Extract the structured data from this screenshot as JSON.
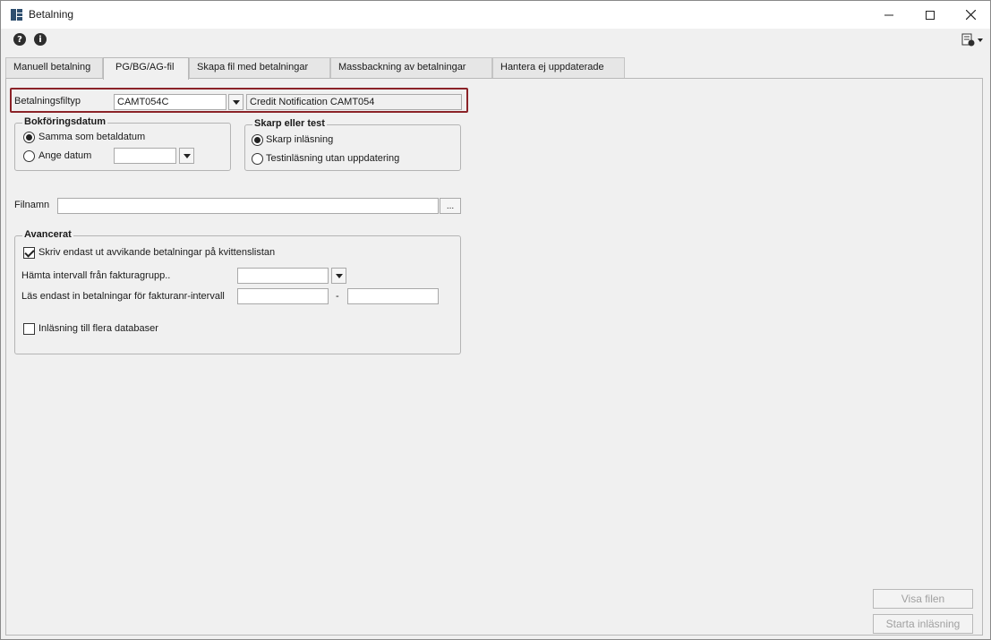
{
  "window": {
    "title": "Betalning"
  },
  "toolbar": {
    "help_icon_glyph": "?",
    "info_icon_glyph": "i"
  },
  "tabs": [
    {
      "label": "Manuell betalning",
      "active": false
    },
    {
      "label": "PG/BG/AG-fil",
      "active": true
    },
    {
      "label": "Skapa fil med betalningar",
      "active": false
    },
    {
      "label": "Massbackning av betalningar",
      "active": false
    },
    {
      "label": "Hantera ej uppdaterade",
      "active": false
    }
  ],
  "filetype": {
    "label": "Betalningsfiltyp",
    "value": "CAMT054C",
    "description": "Credit Notification CAMT054"
  },
  "bookdate": {
    "title": "Bokföringsdatum",
    "option_same": "Samma som betaldatum",
    "option_specify": "Ange datum",
    "date_value": "",
    "selected": "same"
  },
  "mode": {
    "title": "Skarp eller test",
    "option_live": "Skarp inläsning",
    "option_test": "Testinläsning utan uppdatering",
    "selected": "live"
  },
  "file": {
    "label": "Filnamn",
    "value": "",
    "browse_label": "..."
  },
  "advanced": {
    "title": "Avancerat",
    "only_deviating_label": "Skriv endast ut avvikande betalningar på kvittenslistan",
    "only_deviating_checked": true,
    "interval_group_label": "Hämta intervall från fakturagrupp..",
    "interval_group_value": "",
    "invoice_range_label": "Läs endast in betalningar för fakturanr-intervall",
    "invoice_from": "",
    "range_separator": "-",
    "invoice_to": "",
    "multi_db_label": "Inläsning till flera databaser",
    "multi_db_checked": false
  },
  "actions": {
    "show_file_label": "Visa filen",
    "start_import_label": "Starta inläsning"
  },
  "colors": {
    "highlight_border": "#8b2328",
    "disabled_text": "#a0a0a0"
  }
}
